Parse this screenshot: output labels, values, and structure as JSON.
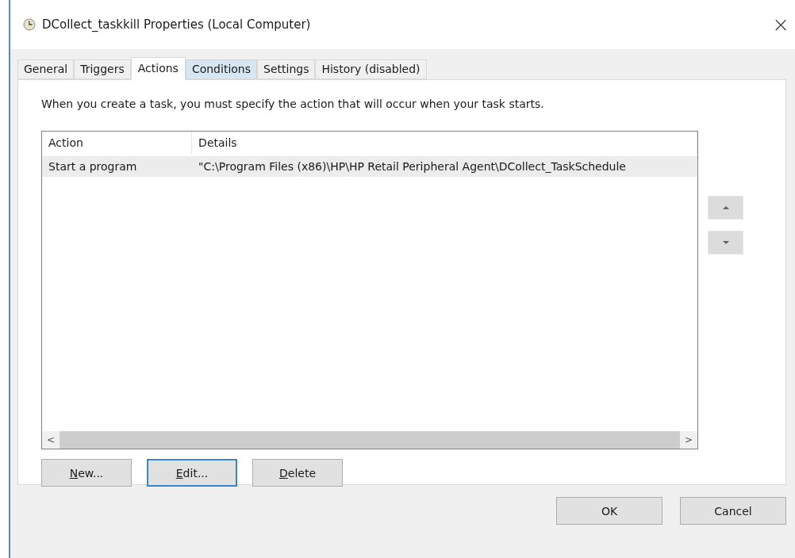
{
  "window": {
    "title": "DCollect_taskkill Properties (Local Computer)",
    "close": "×"
  },
  "tabs": [
    {
      "label": "General",
      "selected": false,
      "hovered": false
    },
    {
      "label": "Triggers",
      "selected": false,
      "hovered": false
    },
    {
      "label": "Actions",
      "selected": true,
      "hovered": false
    },
    {
      "label": "Conditions",
      "selected": false,
      "hovered": true
    },
    {
      "label": "Settings",
      "selected": false,
      "hovered": false
    },
    {
      "label": "History (disabled)",
      "selected": false,
      "hovered": false
    }
  ],
  "description": "When you create a task, you must specify the action that will occur when your task starts.",
  "table": {
    "columns": [
      "Action",
      "Details"
    ],
    "rows": [
      {
        "cells": [
          "Start a program",
          "\"C:\\Program Files (x86)\\HP\\HP Retail Peripheral Agent\\DCollect_TaskSchedule"
        ],
        "selected": true
      }
    ]
  },
  "scroll_left": "<",
  "scroll_right": ">",
  "move_buttons": [
    {
      "kind": "up"
    },
    {
      "kind": "down"
    }
  ],
  "action_buttons": [
    {
      "label": "New...",
      "focused": false
    },
    {
      "label": "Edit...",
      "focused": true
    },
    {
      "label": "Delete",
      "focused": false
    }
  ],
  "dialog_buttons": [
    "OK",
    "Cancel"
  ]
}
